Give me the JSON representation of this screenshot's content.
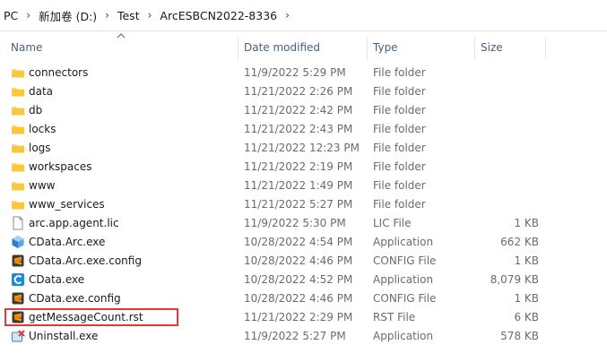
{
  "breadcrumb": {
    "items": [
      "PC",
      "新加卷 (D:)",
      "Test",
      "ArcESBCN2022-8336"
    ]
  },
  "columns": {
    "name": "Name",
    "date": "Date modified",
    "type": "Type",
    "size": "Size"
  },
  "files": [
    {
      "name": "connectors",
      "date": "11/9/2022 5:29 PM",
      "type": "File folder",
      "size": "",
      "icon": "folder-icon"
    },
    {
      "name": "data",
      "date": "11/21/2022 2:26 PM",
      "type": "File folder",
      "size": "",
      "icon": "folder-icon"
    },
    {
      "name": "db",
      "date": "11/21/2022 2:42 PM",
      "type": "File folder",
      "size": "",
      "icon": "folder-icon"
    },
    {
      "name": "locks",
      "date": "11/21/2022 2:43 PM",
      "type": "File folder",
      "size": "",
      "icon": "folder-icon"
    },
    {
      "name": "logs",
      "date": "11/21/2022 12:23 PM",
      "type": "File folder",
      "size": "",
      "icon": "folder-icon"
    },
    {
      "name": "workspaces",
      "date": "11/21/2022 2:19 PM",
      "type": "File folder",
      "size": "",
      "icon": "folder-icon"
    },
    {
      "name": "www",
      "date": "11/21/2022 1:49 PM",
      "type": "File folder",
      "size": "",
      "icon": "folder-icon"
    },
    {
      "name": "www_services",
      "date": "11/21/2022 5:27 PM",
      "type": "File folder",
      "size": "",
      "icon": "folder-icon"
    },
    {
      "name": "arc.app.agent.lic",
      "date": "11/9/2022 5:30 PM",
      "type": "LIC File",
      "size": "1 KB",
      "icon": "document-icon"
    },
    {
      "name": "CData.Arc.exe",
      "date": "10/28/2022 4:54 PM",
      "type": "Application",
      "size": "662 KB",
      "icon": "cube-app-icon"
    },
    {
      "name": "CData.Arc.exe.config",
      "date": "10/28/2022 4:46 PM",
      "type": "CONFIG File",
      "size": "1 KB",
      "icon": "sublime-file-icon"
    },
    {
      "name": "CData.exe",
      "date": "10/28/2022 4:52 PM",
      "type": "Application",
      "size": "8,079 KB",
      "icon": "cdata-app-icon"
    },
    {
      "name": "CData.exe.config",
      "date": "10/28/2022 4:46 PM",
      "type": "CONFIG File",
      "size": "1 KB",
      "icon": "sublime-file-icon"
    },
    {
      "name": "getMessageCount.rst",
      "date": "11/21/2022 2:29 PM",
      "type": "RST File",
      "size": "6 KB",
      "icon": "sublime-file-icon"
    },
    {
      "name": "Uninstall.exe",
      "date": "11/9/2022 5:27 PM",
      "type": "Application",
      "size": "578 KB",
      "icon": "uninstall-icon"
    }
  ],
  "highlight_color": "#e0383b"
}
